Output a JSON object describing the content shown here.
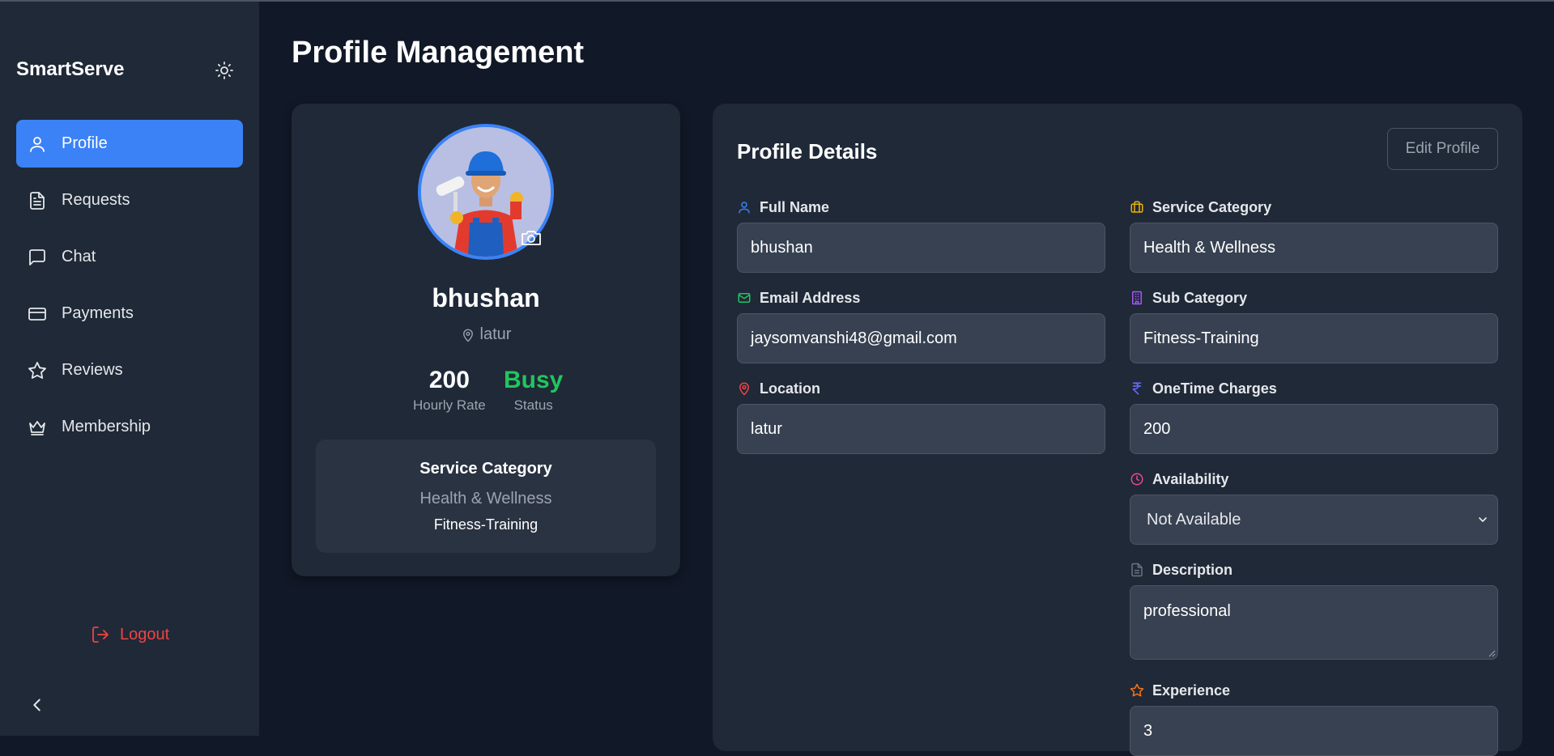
{
  "app": {
    "brand": "SmartServe"
  },
  "sidebar": {
    "items": [
      {
        "label": "Profile",
        "icon": "user-icon",
        "active": true
      },
      {
        "label": "Requests",
        "icon": "document-icon",
        "active": false
      },
      {
        "label": "Chat",
        "icon": "chat-icon",
        "active": false
      },
      {
        "label": "Payments",
        "icon": "credit-card-icon",
        "active": false
      },
      {
        "label": "Reviews",
        "icon": "star-icon",
        "active": false
      },
      {
        "label": "Membership",
        "icon": "crown-icon",
        "active": false
      }
    ],
    "logout_label": "Logout"
  },
  "page": {
    "title": "Profile Management"
  },
  "profile_card": {
    "name": "bhushan",
    "location": "latur",
    "hourly_rate_value": "200",
    "hourly_rate_label": "Hourly Rate",
    "status_value": "Busy",
    "status_label": "Status",
    "service_box": {
      "title": "Service Category",
      "category": "Health & Wellness",
      "subcategory": "Fitness-Training"
    }
  },
  "details": {
    "title": "Profile Details",
    "edit_label": "Edit Profile",
    "full_name": {
      "label": "Full Name",
      "value": "bhushan"
    },
    "email": {
      "label": "Email Address",
      "value": "jaysomvanshi48@gmail.com"
    },
    "location": {
      "label": "Location",
      "value": "latur"
    },
    "service_category": {
      "label": "Service Category",
      "value": "Health & Wellness"
    },
    "sub_category": {
      "label": "Sub Category",
      "value": "Fitness-Training"
    },
    "onetime_charges": {
      "label": "OneTime Charges",
      "value": "200"
    },
    "availability": {
      "label": "Availability",
      "value": "Not Available"
    },
    "description": {
      "label": "Description",
      "value": "professional"
    },
    "experience": {
      "label": "Experience",
      "value": "3"
    }
  },
  "colors": {
    "accent": "#3b82f6",
    "status_busy": "#22c55e",
    "logout": "#ef4444",
    "background": "#111827",
    "card": "#1f2937"
  }
}
